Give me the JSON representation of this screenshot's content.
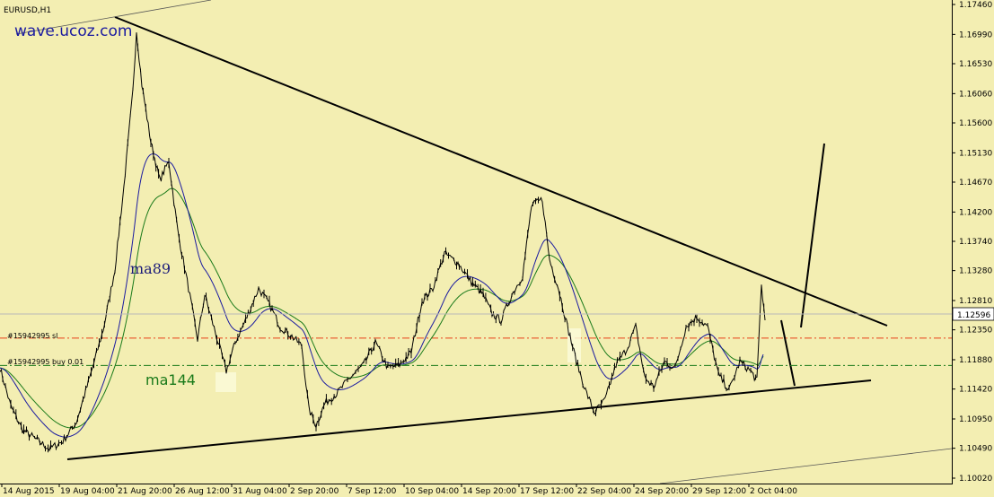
{
  "chart_data": {
    "type": "line",
    "title": "EURUSD,H1",
    "watermark": "wave.ucoz.com",
    "ylim": [
      1.0991,
      1.175
    ],
    "y_ticks": [
      "1.17460",
      "1.16990",
      "1.16530",
      "1.16060",
      "1.15600",
      "1.15130",
      "1.14670",
      "1.14200",
      "1.13740",
      "1.13280",
      "1.12810",
      "1.12350",
      "1.11880",
      "1.11420",
      "1.10950",
      "1.10490",
      "1.10020"
    ],
    "x_ticks": [
      "14 Aug 2015",
      "19 Aug 04:00",
      "21 Aug 20:00",
      "26 Aug 12:00",
      "31 Aug 04:00",
      "2 Sep 20:00",
      "7 Sep 12:00",
      "10 Sep 04:00",
      "14 Sep 20:00",
      "17 Sep 12:00",
      "22 Sep 04:00",
      "24 Sep 20:00",
      "29 Sep 12:00",
      "2 Oct 04:00"
    ],
    "current_price": "1.12596",
    "series": [
      {
        "name": "ma89",
        "color": "#1a1aa0"
      },
      {
        "name": "ma144",
        "color": "#1a7a1a"
      }
    ],
    "levels": [
      {
        "label": "#15942995 sl",
        "price": 1.1222,
        "color": "#e8401a"
      },
      {
        "label": "#15942995 buy 0.01",
        "price": 1.1179,
        "color": "#1a7a1a"
      }
    ],
    "price_anchors": [
      [
        0,
        1.1175
      ],
      [
        12,
        1.1115
      ],
      [
        25,
        1.1078
      ],
      [
        40,
        1.1063
      ],
      [
        55,
        1.1048
      ],
      [
        70,
        1.106
      ],
      [
        85,
        1.109
      ],
      [
        100,
        1.116
      ],
      [
        115,
        1.1235
      ],
      [
        128,
        1.133
      ],
      [
        138,
        1.146
      ],
      [
        148,
        1.161
      ],
      [
        152,
        1.1705
      ],
      [
        158,
        1.162
      ],
      [
        168,
        1.153
      ],
      [
        178,
        1.147
      ],
      [
        188,
        1.15
      ],
      [
        198,
        1.139
      ],
      [
        210,
        1.13
      ],
      [
        220,
        1.122
      ],
      [
        228,
        1.129
      ],
      [
        240,
        1.123
      ],
      [
        252,
        1.117
      ],
      [
        262,
        1.1215
      ],
      [
        275,
        1.1255
      ],
      [
        288,
        1.13
      ],
      [
        300,
        1.1275
      ],
      [
        312,
        1.124
      ],
      [
        325,
        1.1225
      ],
      [
        336,
        1.121
      ],
      [
        344,
        1.111
      ],
      [
        352,
        1.1085
      ],
      [
        362,
        1.112
      ],
      [
        375,
        1.1135
      ],
      [
        390,
        1.116
      ],
      [
        405,
        1.118
      ],
      [
        418,
        1.1215
      ],
      [
        432,
        1.1175
      ],
      [
        445,
        1.118
      ],
      [
        458,
        1.12
      ],
      [
        470,
        1.128
      ],
      [
        482,
        1.13
      ],
      [
        495,
        1.1355
      ],
      [
        510,
        1.134
      ],
      [
        525,
        1.131
      ],
      [
        538,
        1.129
      ],
      [
        548,
        1.126
      ],
      [
        558,
        1.125
      ],
      [
        570,
        1.129
      ],
      [
        582,
        1.132
      ],
      [
        592,
        1.143
      ],
      [
        604,
        1.144
      ],
      [
        612,
        1.1345
      ],
      [
        622,
        1.13
      ],
      [
        632,
        1.124
      ],
      [
        642,
        1.1185
      ],
      [
        652,
        1.114
      ],
      [
        662,
        1.1105
      ],
      [
        674,
        1.1125
      ],
      [
        686,
        1.118
      ],
      [
        698,
        1.1205
      ],
      [
        708,
        1.124
      ],
      [
        718,
        1.116
      ],
      [
        728,
        1.1145
      ],
      [
        740,
        1.1185
      ],
      [
        752,
        1.1175
      ],
      [
        764,
        1.124
      ],
      [
        776,
        1.1255
      ],
      [
        788,
        1.124
      ],
      [
        800,
        1.1165
      ],
      [
        812,
        1.114
      ],
      [
        824,
        1.1185
      ],
      [
        836,
        1.117
      ],
      [
        843,
        1.1155
      ],
      [
        848,
        1.1305
      ],
      [
        852,
        1.125
      ]
    ]
  }
}
